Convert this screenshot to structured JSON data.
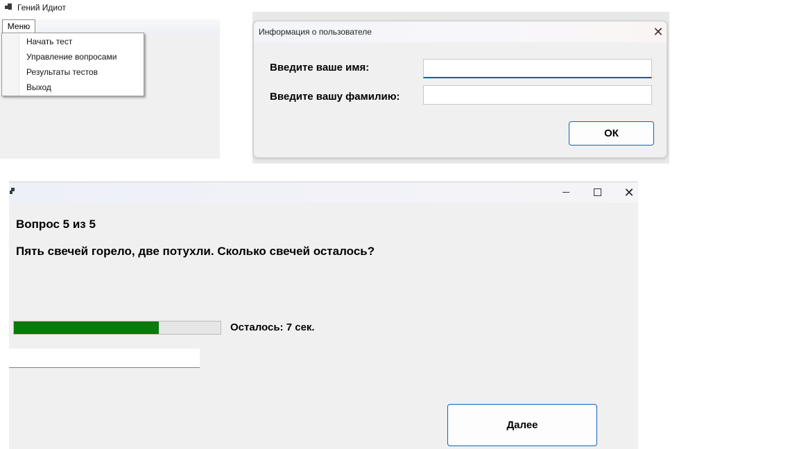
{
  "main_window": {
    "title": "Гений Идиот",
    "menu": {
      "label": "Меню",
      "items": [
        {
          "label": "Начать тест"
        },
        {
          "label": "Управление вопросами"
        },
        {
          "label": "Результаты тестов"
        },
        {
          "label": "Выход"
        }
      ]
    }
  },
  "user_dialog": {
    "title": "Информация о пользователе",
    "first_name_label": "Введите ваше имя:",
    "last_name_label": "Введите вашу фамилию:",
    "first_name_value": "",
    "last_name_value": "",
    "ok_label": "ОК"
  },
  "quiz_window": {
    "question_number": "Вопрос 5 из 5",
    "question_text": "Пять свечей горело, две потухли. Сколько свечей осталось?",
    "timer_label": "Осталось: 7 сек.",
    "timer_progress_fraction": 0.7,
    "timer_fill_color": "#0a7a0a",
    "answer_value": "",
    "next_label": "Далее"
  },
  "icons": {
    "app": "app-icon",
    "close": "close-icon",
    "minimize": "minimize-icon",
    "maximize": "maximize-icon"
  }
}
